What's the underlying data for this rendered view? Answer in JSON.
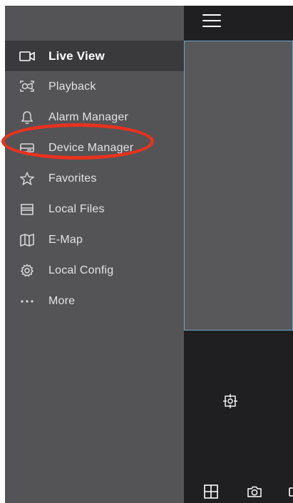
{
  "sidebar": {
    "items": [
      {
        "label": "Live View",
        "icon": "video-camera-icon",
        "active": true
      },
      {
        "label": "Playback",
        "icon": "playback-icon",
        "active": false
      },
      {
        "label": "Alarm Manager",
        "icon": "bell-icon",
        "active": false
      },
      {
        "label": "Device Manager",
        "icon": "device-icon",
        "active": false
      },
      {
        "label": "Favorites",
        "icon": "star-icon",
        "active": false
      },
      {
        "label": "Local Files",
        "icon": "folder-icon",
        "active": false
      },
      {
        "label": "E-Map",
        "icon": "map-icon",
        "active": false
      },
      {
        "label": "Local Config",
        "icon": "gear-icon",
        "active": false
      },
      {
        "label": "More",
        "icon": "more-dots-icon",
        "active": false
      }
    ]
  },
  "colors": {
    "sidebar_bg": "#545456",
    "active_item_bg": "#3a3a3c",
    "app_bg": "#1f1f21",
    "video_border": "#6aa6c9",
    "highlight": "#e8321e"
  }
}
